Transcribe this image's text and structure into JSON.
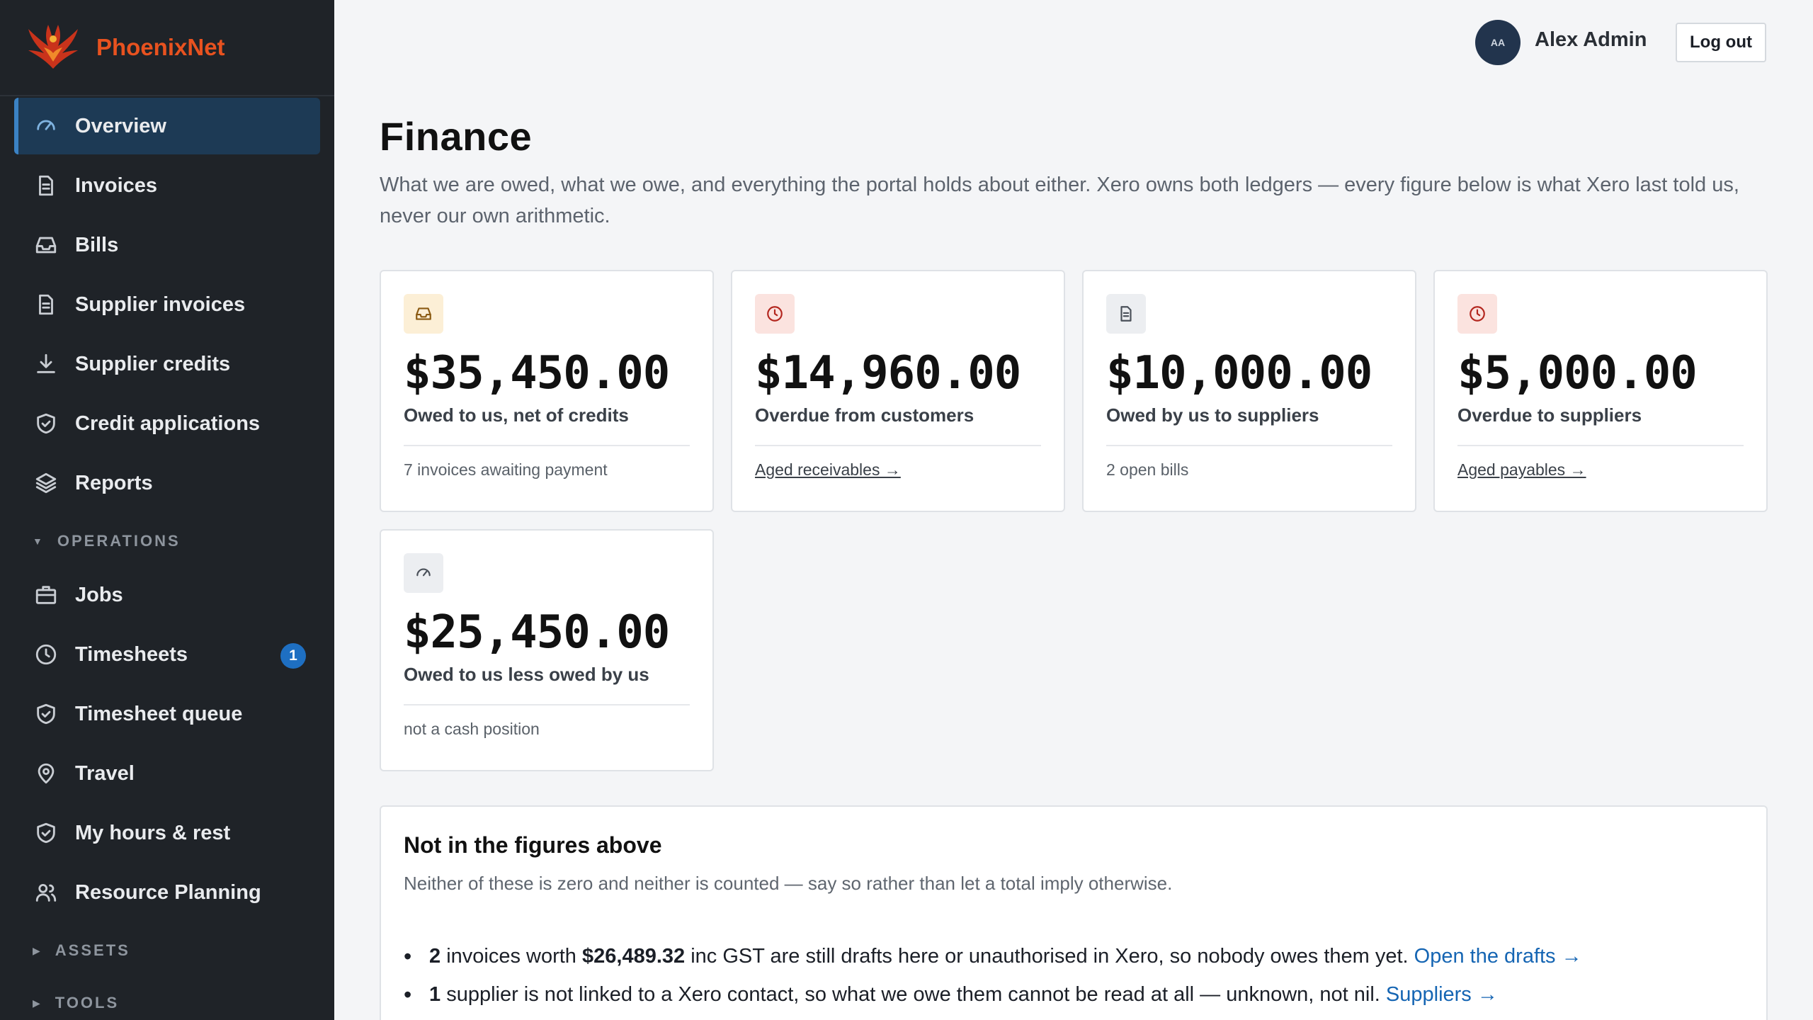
{
  "brand": {
    "name": "PhoenixNet"
  },
  "sidebar": {
    "items": [
      {
        "label": "Overview",
        "icon": "gauge-icon",
        "active": true
      },
      {
        "label": "Invoices",
        "icon": "document-icon"
      },
      {
        "label": "Bills",
        "icon": "inbox-icon"
      },
      {
        "label": "Supplier invoices",
        "icon": "document-icon"
      },
      {
        "label": "Supplier credits",
        "icon": "download-icon"
      },
      {
        "label": "Credit applications",
        "icon": "shield-check-icon"
      },
      {
        "label": "Reports",
        "icon": "layers-icon"
      }
    ],
    "operations_label": "OPERATIONS",
    "operations": [
      {
        "label": "Jobs",
        "icon": "briefcase-icon"
      },
      {
        "label": "Timesheets",
        "icon": "clock-icon",
        "badge": "1"
      },
      {
        "label": "Timesheet queue",
        "icon": "shield-check-icon"
      },
      {
        "label": "Travel",
        "icon": "map-pin-icon"
      },
      {
        "label": "My hours & rest",
        "icon": "shield-check-icon"
      },
      {
        "label": "Resource Planning",
        "icon": "users-icon"
      }
    ],
    "assets_label": "ASSETS",
    "tools_label": "TOOLS"
  },
  "header": {
    "avatar_initials": "AA",
    "user_name": "Alex Admin",
    "logout_label": "Log out"
  },
  "page": {
    "title": "Finance",
    "description": "What we are owed, what we owe, and everything the portal holds about either. Xero owns both ledgers — every figure below is what Xero last told us, never our own arithmetic."
  },
  "cards": [
    {
      "value": "$35,450.00",
      "label": "Owed to us, net of credits",
      "foot": "7 invoices awaiting payment",
      "icon": "inbox-icon",
      "tone": "#fcefd6"
    },
    {
      "value": "$14,960.00",
      "label": "Overdue from customers",
      "foot": "Aged receivables →",
      "icon": "clock-icon",
      "tone": "#fbe3df"
    },
    {
      "value": "$10,000.00",
      "label": "Owed by us to suppliers",
      "foot": "2 open bills",
      "icon": "document-icon",
      "tone": "#eceef1"
    },
    {
      "value": "$5,000.00",
      "label": "Overdue to suppliers",
      "foot": "Aged payables →",
      "icon": "clock-icon",
      "tone": "#fbe3df"
    },
    {
      "value": "$25,450.00",
      "label": "Owed to us less owed by us",
      "foot": "not a cash position",
      "icon": "gauge-icon",
      "tone": "#eceef1"
    }
  ],
  "notice": {
    "title": "Not in the figures above",
    "subtitle": "Neither of these is zero and neither is counted — say so rather than let a total imply otherwise.",
    "line1": {
      "count": "2",
      "text_a": " invoices worth ",
      "amount": "$26,489.32",
      "text_b": " inc GST are still drafts here or unauthorised in Xero, so nobody owes them yet. ",
      "link": "Open the drafts →"
    },
    "line2": {
      "count": "1",
      "text_a": " supplier is not linked to a Xero contact, so what we owe them cannot be read at all — unknown, not nil. ",
      "link": "Suppliers →"
    }
  }
}
